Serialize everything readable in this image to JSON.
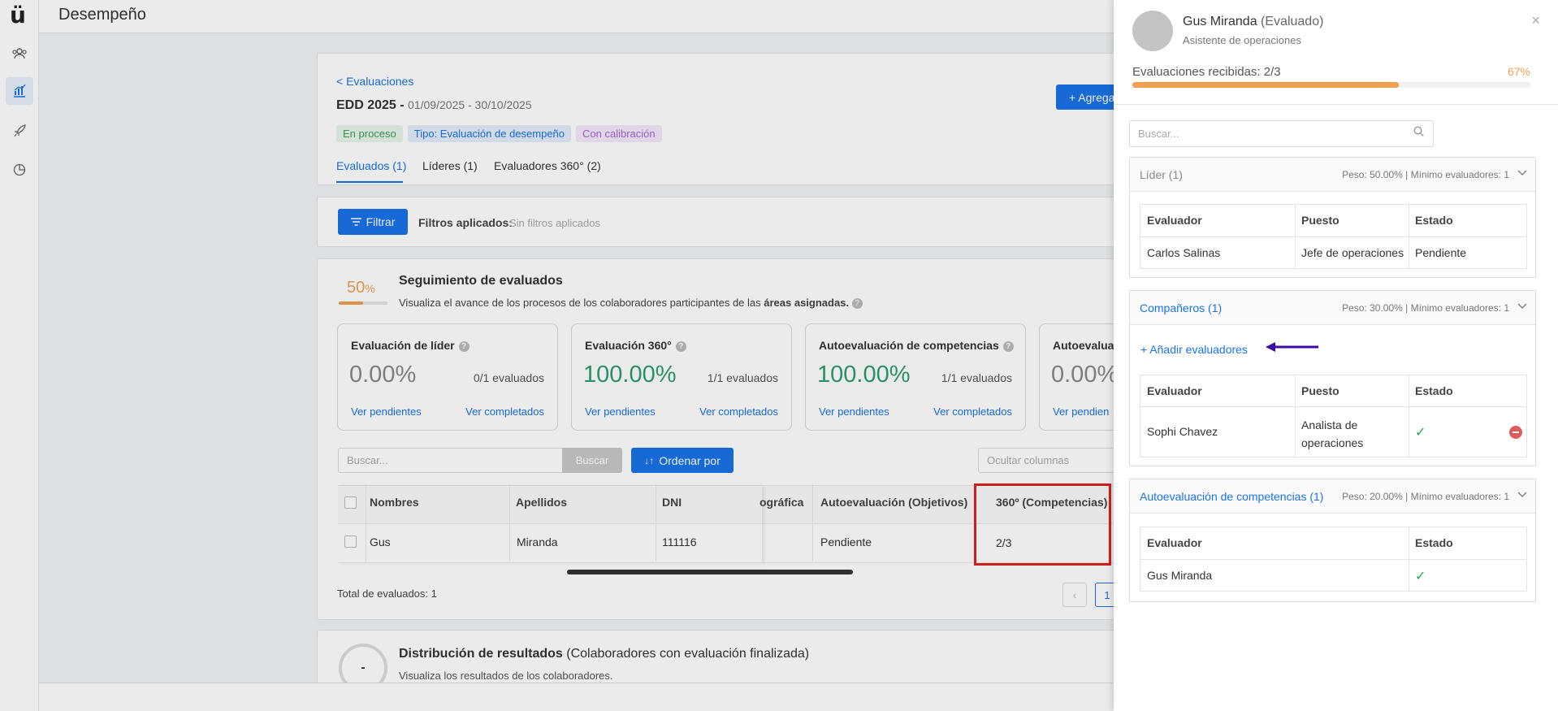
{
  "app": {
    "logo": "ü",
    "page_title": "Desempeño"
  },
  "rail": {
    "icons": [
      "users-icon",
      "chart-icon",
      "rocket-icon",
      "pie-chart-icon"
    ]
  },
  "header_card": {
    "back_link": "< Evaluaciones",
    "eval_name": "EDD 2025",
    "eval_dash": " - ",
    "eval_dates": "01/09/2025 - 30/10/2025",
    "tags": [
      {
        "label": "En proceso",
        "color": "#3c9c5a",
        "bg": "#e7f5ea"
      },
      {
        "label": "Tipo: Evaluación de desempeño",
        "color": "#1a73e8",
        "bg": "#e3eefc"
      },
      {
        "label": "Con calibración",
        "color": "#a366d6",
        "bg": "#f3e9fb"
      }
    ],
    "tabs": [
      "Evaluados (1)",
      "Líderes (1)",
      "Evaluadores 360° (2)"
    ],
    "add_button": "+ Agrega"
  },
  "filters": {
    "button": "Filtrar",
    "label": "Filtros aplicados:",
    "value": "Sin filtros aplicados"
  },
  "tracking": {
    "percent_value": "50",
    "percent_sign": "%",
    "progress": 0.5,
    "title": "Seguimiento de evaluados",
    "desc_prefix": "Visualiza el avance de los procesos de los colaboradores participantes de las ",
    "desc_bold": "áreas asignadas.",
    "metrics": [
      {
        "title": "Evaluación de líder",
        "value": "0.00%",
        "count": "0/1 evaluados",
        "color": "#888",
        "left": "Ver pendientes",
        "right": "Ver completados"
      },
      {
        "title": "Evaluación 360°",
        "value": "100.00%",
        "count": "1/1 evaluados",
        "color": "#2e9e6e",
        "left": "Ver pendientes",
        "right": "Ver completados"
      },
      {
        "title": "Autoevaluación de competencias",
        "value": "100.00%",
        "count": "1/1 evaluados",
        "color": "#2e9e6e",
        "left": "Ver pendientes",
        "right": "Ver completados"
      },
      {
        "title": "Autoevalua",
        "value": "0.00%",
        "count": "",
        "color": "#888",
        "left": "Ver pendien",
        "right": ""
      }
    ]
  },
  "table": {
    "search_placeholder": "Buscar...",
    "search_button": "Buscar",
    "sort_button": "Ordenar por",
    "hide_columns": "Ocultar columnas",
    "headers": [
      "Nombres",
      "Apellidos",
      "DNI",
      "ográfica",
      "Autoevaluación (Objetivos)",
      "360º (Competencias)"
    ],
    "row": {
      "nombre": "Gus",
      "apellido": "Miranda",
      "dni": "111116",
      "auto": "Pendiente",
      "c360": "2/3"
    },
    "total": "Total de evaluados: 1",
    "page": "1"
  },
  "distribution": {
    "badge": "-",
    "title_bold": "Distribución de resultados",
    "title_rest": " (Colaboradores con evaluación finalizada)",
    "desc": "Visualiza los resultados de los colaboradores."
  },
  "drawer": {
    "name": "Gus Miranda",
    "role_tag": " (Evaluado)",
    "position": "Asistente de operaciones",
    "received_label": "Evaluaciones recibidas: 2/3",
    "received_percent": "67%",
    "received_progress": 0.67,
    "search_placeholder": "Buscar...",
    "sections": {
      "lider": {
        "title": "Líder (1)",
        "weight": "Peso: 50.00% | Mínimo evaluadores: 1",
        "headers": [
          "Evaluador",
          "Puesto",
          "Estado"
        ],
        "row": [
          "Carlos Salinas",
          "Jefe de operaciones",
          "Pendiente"
        ]
      },
      "companeros": {
        "title": "Compañeros (1)",
        "weight": "Peso: 30.00% | Mínimo evaluadores: 1",
        "add_link": "+ Añadir evaluadores",
        "headers": [
          "Evaluador",
          "Puesto",
          "Estado"
        ],
        "row": [
          "Sophi Chavez",
          "Analista de operaciones",
          "✓"
        ]
      },
      "auto": {
        "title": "Autoevaluación de competencias (1)",
        "weight": "Peso: 20.00% | Mínimo evaluadores: 1",
        "headers": [
          "Evaluador",
          "Estado"
        ],
        "row": [
          "Gus Miranda",
          "✓"
        ]
      }
    }
  },
  "colors": {
    "accent": "#1a73e8",
    "orange": "#f0a050",
    "highlight_box": "#e02020",
    "arrow": "#3a0ca3"
  }
}
